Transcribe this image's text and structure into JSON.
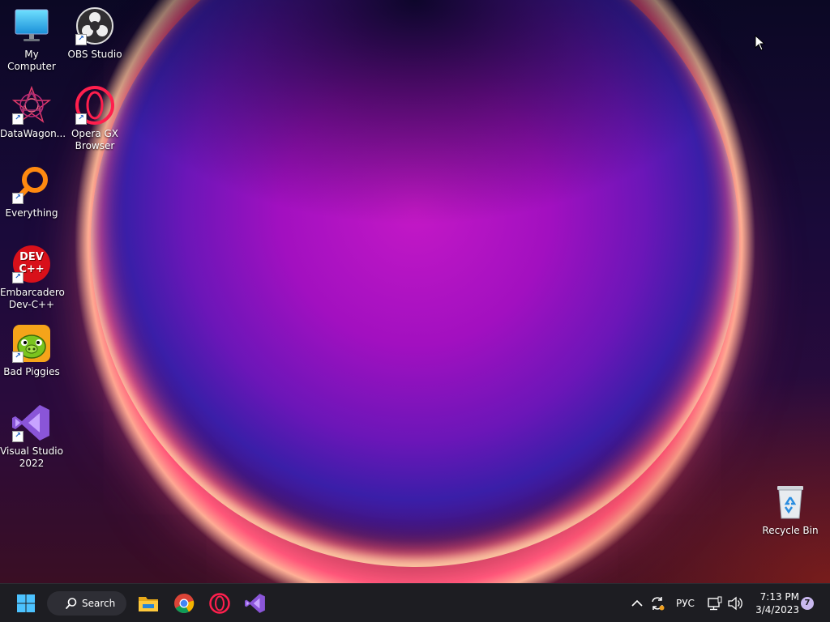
{
  "desktop": {
    "icons": [
      {
        "label": "My Computer",
        "icon": "monitor-icon"
      },
      {
        "label": "OBS Studio",
        "icon": "obs-icon"
      },
      {
        "label": "DataWagon...",
        "icon": "datawagon-icon"
      },
      {
        "label": "Opera GX Browser",
        "icon": "opera-gx-icon"
      },
      {
        "label": "Everything",
        "icon": "magnifier-icon"
      },
      {
        "label": "Embarcadero Dev-C++",
        "icon": "devcpp-icon",
        "badge": "DEV C++"
      },
      {
        "label": "Bad Piggies",
        "icon": "bad-piggies-icon"
      },
      {
        "label": "Visual Studio 2022",
        "icon": "visual-studio-icon"
      },
      {
        "label": "Recycle Bin",
        "icon": "recycle-bin-icon"
      }
    ]
  },
  "taskbar": {
    "search_label": "Search",
    "language": "РУС",
    "time": "7:13 PM",
    "date": "3/4/2023",
    "notification_count": "7"
  }
}
